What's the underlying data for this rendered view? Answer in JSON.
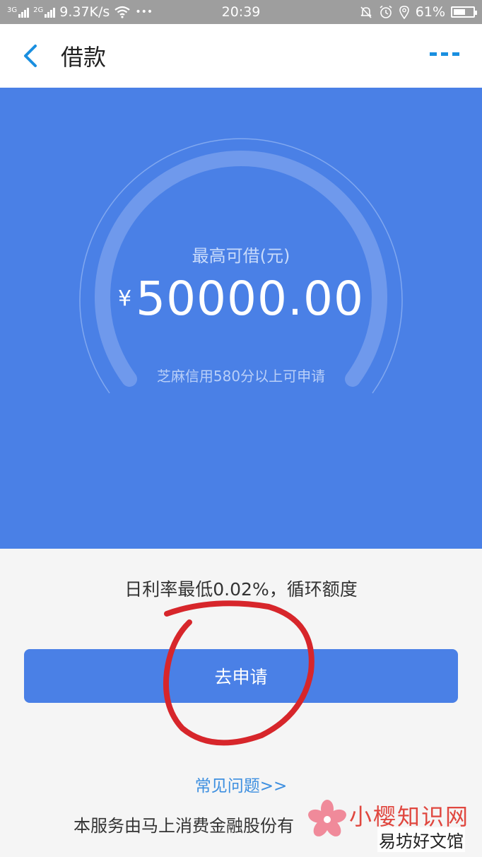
{
  "status_bar": {
    "net1": "3G",
    "net2": "2G",
    "speed": "9.37K/s",
    "dots": "•••",
    "time": "20:39",
    "battery": "61%",
    "battery_level": 0.61
  },
  "nav": {
    "title": "借款"
  },
  "hero": {
    "label": "最高可借(元)",
    "currency": "¥",
    "amount": "50000.00",
    "note": "芝麻信用580分以上可申请"
  },
  "rate_text": "日利率最低0.02%，循环额度",
  "apply_button": "去申请",
  "faq_link": "常见问题>>",
  "footer_text": "本服务由马上消费金融股份有",
  "watermark": {
    "line1": "小樱知识网",
    "line2": "易坊好文馆"
  },
  "colors": {
    "brand_blue": "#4a80e6",
    "link_blue": "#3d8fe0",
    "annotation_red": "#d7262b"
  }
}
